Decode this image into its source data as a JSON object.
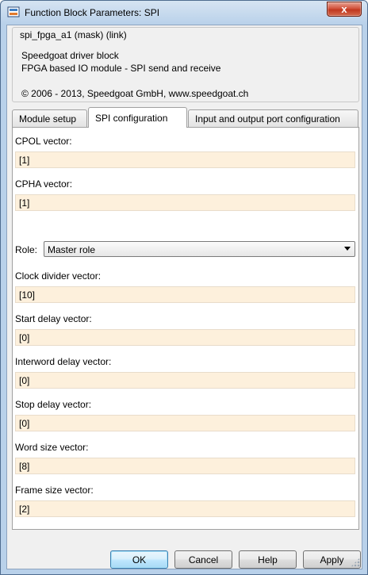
{
  "window": {
    "title": "Function Block Parameters: SPI",
    "close_label": "x"
  },
  "description": {
    "legend": "spi_fpga_a1 (mask) (link)",
    "line1": "Speedgoat driver block",
    "line2": "FPGA based IO module - SPI send and receive",
    "line3": "© 2006 - 2013, Speedgoat GmbH, www.speedgoat.ch"
  },
  "tabs": [
    {
      "label": "Module setup",
      "active": false
    },
    {
      "label": "SPI configuration",
      "active": true
    },
    {
      "label": "Input and output port configuration",
      "active": false
    }
  ],
  "fields": {
    "cpol": {
      "label": "CPOL vector:",
      "value": "[1]"
    },
    "cpha": {
      "label": "CPHA vector:",
      "value": "[1]"
    },
    "role": {
      "label": "Role:",
      "value": "Master role"
    },
    "clock_divider": {
      "label": "Clock divider vector:",
      "value": "[10]"
    },
    "start_delay": {
      "label": "Start delay vector:",
      "value": "[0]"
    },
    "interword_delay": {
      "label": "Interword delay vector:",
      "value": "[0]"
    },
    "stop_delay": {
      "label": "Stop delay vector:",
      "value": "[0]"
    },
    "word_size": {
      "label": "Word size vector:",
      "value": "[8]"
    },
    "frame_size": {
      "label": "Frame size vector:",
      "value": "[2]"
    }
  },
  "buttons": {
    "ok": "OK",
    "cancel": "Cancel",
    "help": "Help",
    "apply": "Apply"
  },
  "colors": {
    "input_background": "#fdf0dc",
    "default_button": "#bee6fd",
    "close_button": "#c0381f"
  }
}
